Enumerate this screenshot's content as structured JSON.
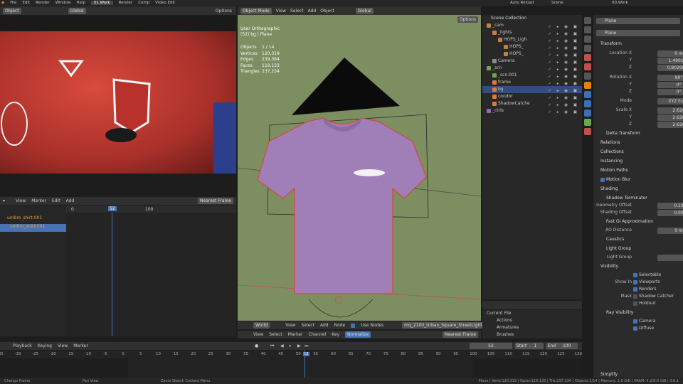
{
  "topbar": {
    "menus": [
      "File",
      "Edit",
      "Render",
      "Window",
      "Help"
    ],
    "workspaces": [
      "01.Work",
      "Render",
      "Comp",
      "Video Edit"
    ],
    "auto_reload": "Auto Reload",
    "scene": "Scene",
    "view_layer": "00.Work"
  },
  "image_editor": {
    "mode": "Object",
    "orientation": "Global",
    "options": "Options"
  },
  "viewport": {
    "mode": "Object Mode",
    "menus": [
      "View",
      "Select",
      "Add",
      "Object"
    ],
    "orientation": "Global",
    "options": "Options",
    "info": [
      "User Orthographic",
      "(52) bg | Plane"
    ],
    "stats": [
      {
        "label": "Objects",
        "value": "1 / 14"
      },
      {
        "label": "Vertices",
        "value": "120,319"
      },
      {
        "label": "Edges",
        "value": "239,364"
      },
      {
        "label": "Faces",
        "value": "119,133"
      },
      {
        "label": "Triangles",
        "value": "237,234"
      }
    ],
    "bg_color": "#7d8e60",
    "shirt_color": "#a07fb8"
  },
  "node_header": {
    "world": "World",
    "menus": [
      "View",
      "Select",
      "Add",
      "Node"
    ],
    "use_nodes": "Use Nodes",
    "image_name": "mq_2100_Urban_Square_StreetLight.001"
  },
  "dopesheet": {
    "menus": [
      "View",
      "Marker",
      "Edit",
      "Add"
    ],
    "interp": "Nearest Frame",
    "ruler": [
      "0",
      "52",
      "100"
    ],
    "channels": [
      "umbro_shirt.001",
      "umbro_shirt.001"
    ]
  },
  "graph_header": {
    "menus": [
      "View",
      "Select",
      "Marker",
      "Channel",
      "Key"
    ],
    "normalize": "Normalize",
    "interp": "Nearest Frame"
  },
  "outliner": {
    "header": "Scene Collection",
    "items": [
      {
        "label": "_cam",
        "indent": 0,
        "color": "#c77f3d"
      },
      {
        "label": "_lights",
        "indent": 1,
        "color": "#c77f3d"
      },
      {
        "label": "HOPS_Ligh",
        "indent": 2,
        "color": "#c77f3d"
      },
      {
        "label": "HOPS_",
        "indent": 3,
        "color": "#c77f3d"
      },
      {
        "label": "HOPS_",
        "indent": 3,
        "color": "#c77f3d"
      },
      {
        "label": "Camera",
        "indent": 1,
        "color": "#8a8a8a"
      },
      {
        "label": "_scn",
        "indent": 0,
        "color": "#6aa84f"
      },
      {
        "label": "_scn.001",
        "indent": 1,
        "color": "#6aa84f"
      },
      {
        "label": "frame",
        "indent": 1,
        "color": "#e07a3a"
      },
      {
        "label": "bg",
        "indent": 1,
        "color": "#e07a3a",
        "selected": true
      },
      {
        "label": "condor",
        "indent": 1,
        "color": "#e07a3a"
      },
      {
        "label": "ShadowCatche",
        "indent": 1,
        "color": "#e07a3a"
      },
      {
        "label": "_ctrls",
        "indent": 0,
        "color": "#8e6bb5"
      }
    ]
  },
  "file_browser": {
    "header": "Current File",
    "items": [
      "Actions",
      "Armatures",
      "Brushes"
    ]
  },
  "properties": {
    "object_name": "Plane",
    "data_name": "Plane",
    "transform": "Transform",
    "location": [
      {
        "axis": "Location X",
        "value": "0 m"
      },
      {
        "axis": "Y",
        "value": "1.4901 m"
      },
      {
        "axis": "Z",
        "value": "0.80298 m"
      }
    ],
    "rotation": [
      {
        "axis": "Rotation X",
        "value": "90°"
      },
      {
        "axis": "Y",
        "value": "0°"
      },
      {
        "axis": "Z",
        "value": "0°"
      }
    ],
    "mode_label": "Mode",
    "mode_value": "XYZ Euler",
    "scale": [
      {
        "axis": "Scale X",
        "value": "2.620"
      },
      {
        "axis": "Y",
        "value": "2.620"
      },
      {
        "axis": "Z",
        "value": "2.620"
      }
    ],
    "sections": [
      "Delta Transform",
      "Relations",
      "Collections",
      "Instancing",
      "Motion Paths",
      "Motion Blur",
      "Shading"
    ],
    "shadow_terminator": "Shadow Terminator",
    "geo_offset": {
      "label": "Geometry Offset",
      "value": "0.10"
    },
    "shade_offset": {
      "label": "Shading Offset",
      "value": "0.00"
    },
    "fast_gi": "Fast GI Approximation",
    "ao_distance": {
      "label": "AO Distance",
      "value": "0 m"
    },
    "caustics": "Caustics",
    "light_group": "Light Group",
    "light_group_label": "Light Group",
    "visibility": "Visibility",
    "selectable": "Selectable",
    "show_in": "Show In",
    "viewports": "Viewports",
    "renders": "Renders",
    "mask": "Mask",
    "shadow_catcher": "Shadow Catcher",
    "holdout": "Holdout",
    "ray_visibility": "Ray Visibility",
    "camera": "Camera",
    "diffuse": "Diffuse",
    "simplify": "Simplify"
  },
  "timeline": {
    "menus": [
      "Playback",
      "Keying",
      "View",
      "Marker"
    ],
    "current": "52",
    "start_label": "Start",
    "start": "1",
    "end_label": "End",
    "end": "100",
    "ticks": [
      "35",
      "-30",
      "-25",
      "-20",
      "-15",
      "-10",
      "-5",
      "0",
      "5",
      "10",
      "15",
      "20",
      "25",
      "30",
      "35",
      "40",
      "45",
      "50",
      "52",
      "55",
      "60",
      "65",
      "70",
      "75",
      "80",
      "85",
      "90",
      "95",
      "100",
      "105",
      "110",
      "115",
      "120",
      "125",
      "130"
    ]
  },
  "status": {
    "left": "Change Frame",
    "mid": "Pan View",
    "right": "Zoom Sketch Context Menu",
    "stats": "Plane | Verts:120,319 | Faces:119,133 | Tris:237,234 | Objects:1/14 | Memory: 1.6 GiB | VRAM: 4.2/8.0 GiB | 3.6.1"
  }
}
